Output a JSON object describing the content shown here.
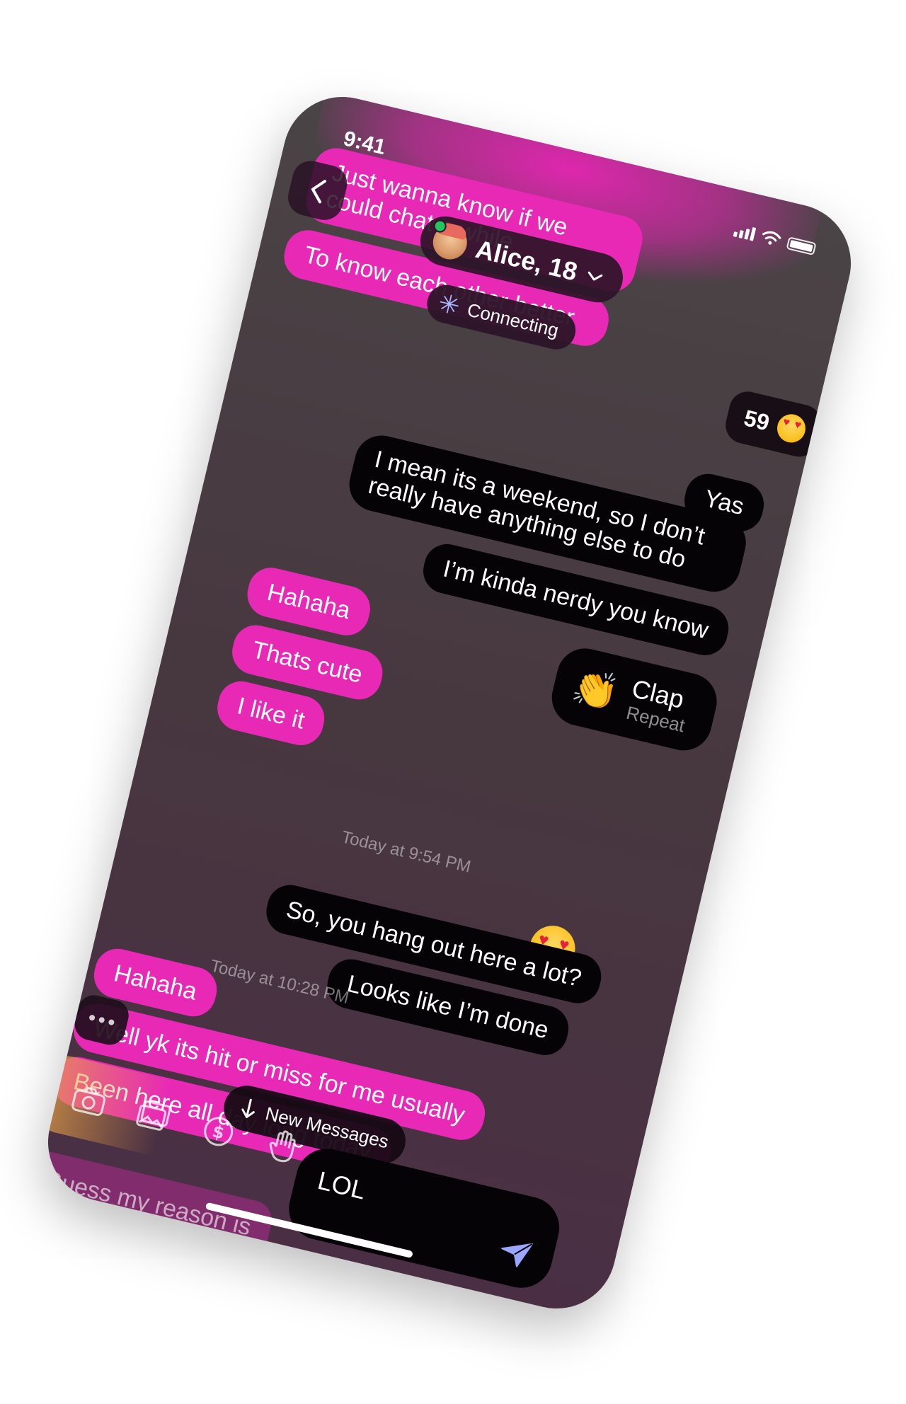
{
  "status_bar": {
    "time": "9:41"
  },
  "header": {
    "back_icon": "chevron-left-icon",
    "contact_name": "Alice, 18",
    "chevron_icon": "chevron-down-icon",
    "status_text": "Connecting",
    "counter_value": "59",
    "counter_emoji": "heart-eyes-emoji"
  },
  "messages": {
    "m1": "Just wanna know if we could chat a while",
    "m2": "To know each other better",
    "m3": "Yas",
    "m4": "I mean its a weekend, so I don’t really have anything else to do",
    "m5": "I’m kinda nerdy you know",
    "m6": "Hahaha",
    "m7": "Thats cute",
    "m8": "I like it",
    "clap_title": "Clap",
    "clap_sub": "Repeat",
    "timestamp1": "Today at 9:54 PM",
    "m9": "So, you hang out here a lot?",
    "m10": "Looks like I’m done",
    "timestamp2": "Today at 10:28 PM",
    "m11": "Hahaha",
    "m12": "Well yk its hit or miss for me usually",
    "m13": "Been here all day long today"
  },
  "new_messages_label": "New Messages",
  "composer": {
    "draft_text": "Guess my reason is",
    "input_value": "LOL"
  },
  "toolbar": {
    "icons": [
      "camera-icon",
      "gallery-icon",
      "dollar-icon",
      "wave-icon"
    ]
  },
  "colors": {
    "accent_pink": "#e829b6",
    "bubble_dark": "#050305"
  }
}
